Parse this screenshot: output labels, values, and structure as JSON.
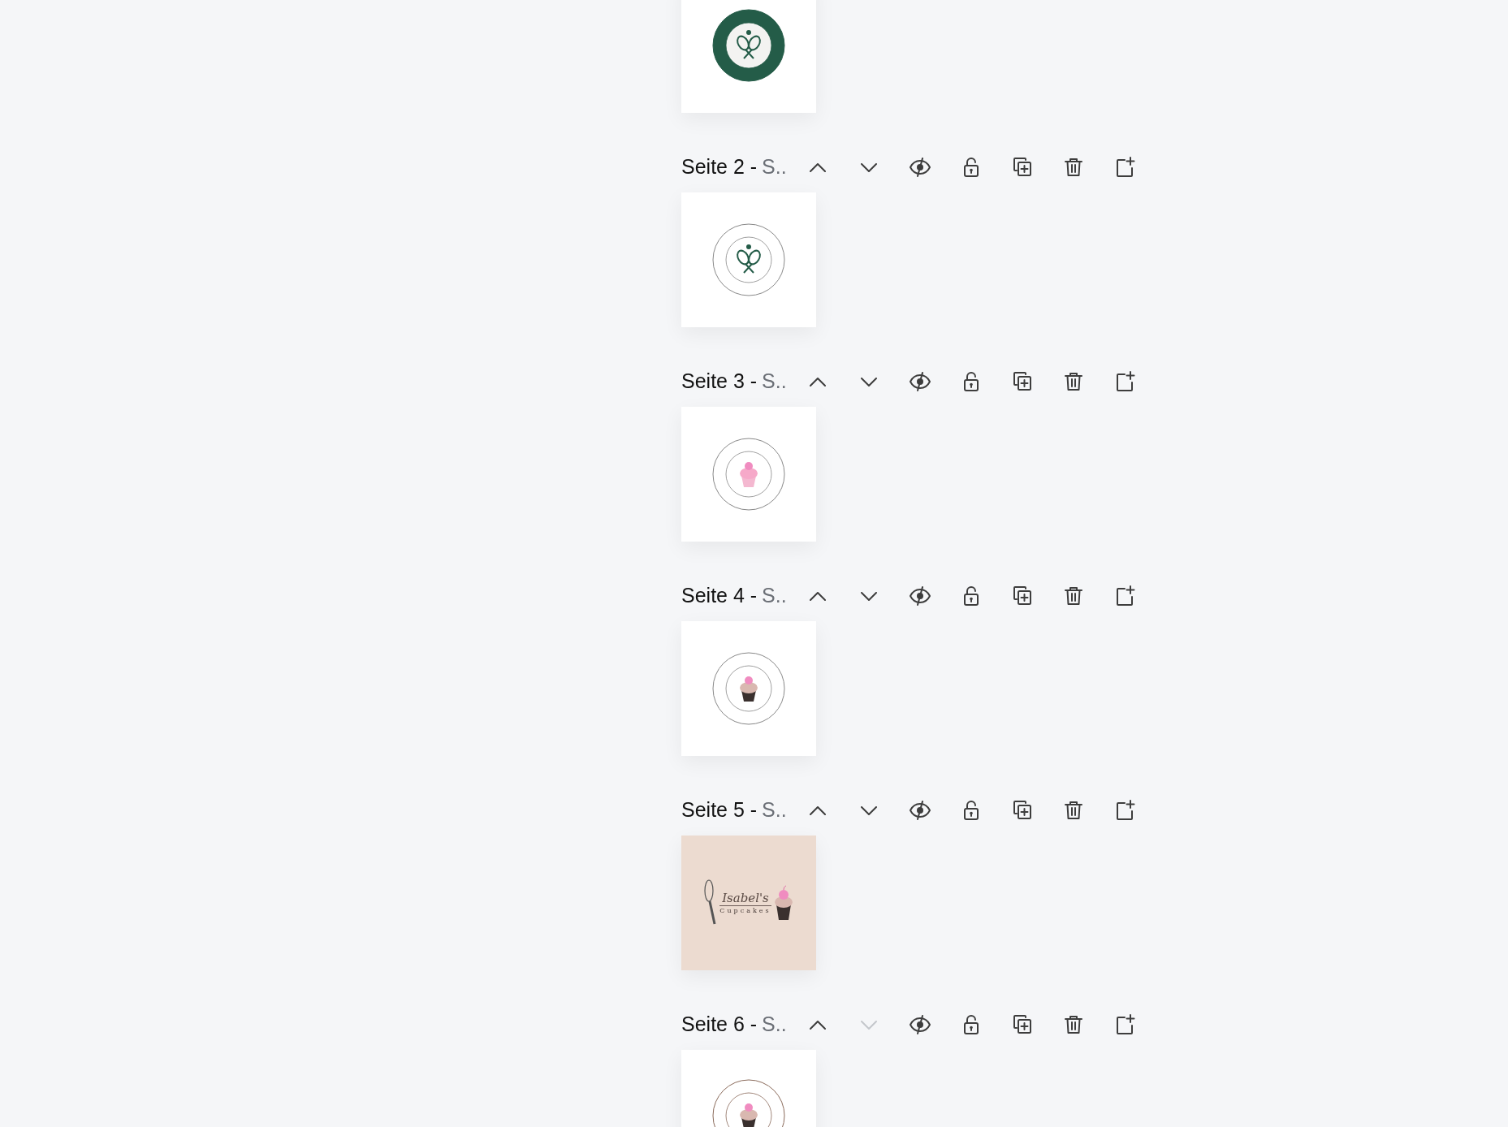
{
  "top_thumbnail": {
    "kind": "tennis_filled"
  },
  "pages": [
    {
      "title": "Seite 2 -",
      "subtitle": "S..",
      "down_disabled": false,
      "thumbnail": {
        "kind": "tennis_outline"
      }
    },
    {
      "title": "Seite 3 -",
      "subtitle": "S..",
      "down_disabled": false,
      "thumbnail": {
        "kind": "cupcake_pink"
      }
    },
    {
      "title": "Seite 4 -",
      "subtitle": "S..",
      "down_disabled": false,
      "thumbnail": {
        "kind": "cupcake_dark"
      }
    },
    {
      "title": "Seite 5 -",
      "subtitle": "S..",
      "down_disabled": false,
      "thumbnail": {
        "kind": "cupcake_banner",
        "script_text": "Isabel's",
        "caption": "Cupcakes"
      }
    },
    {
      "title": "Seite 6 -",
      "subtitle": "S..",
      "down_disabled": true,
      "thumbnail": {
        "kind": "cupcake_studio"
      }
    }
  ]
}
